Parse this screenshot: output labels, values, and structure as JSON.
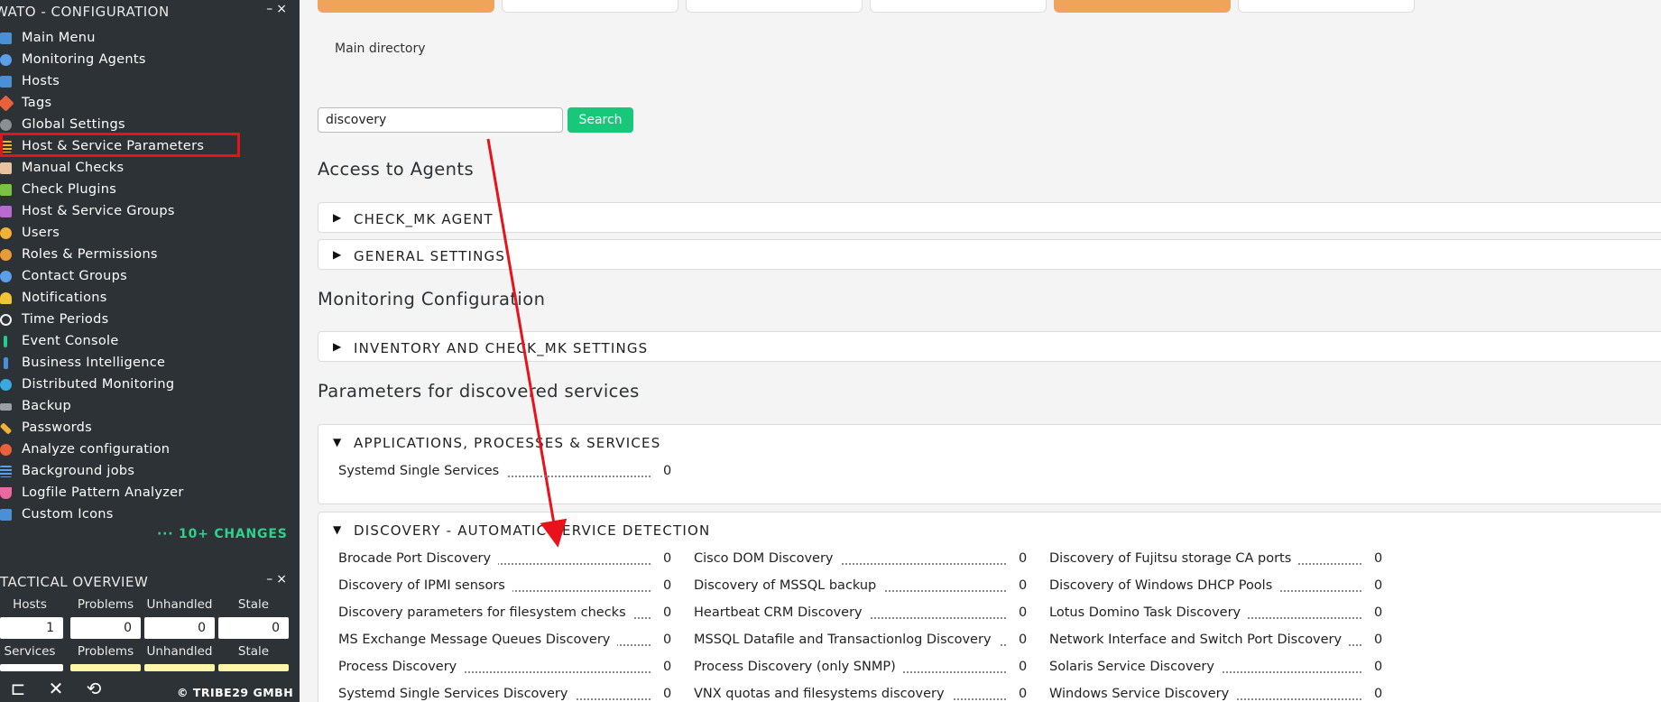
{
  "sidebar": {
    "config_title": "WATO - CONFIGURATION",
    "config_controls": "–×",
    "menu": [
      {
        "label": "Main Menu",
        "icon": "home-icon",
        "color": "#4a90d9"
      },
      {
        "label": "Monitoring Agents",
        "icon": "agent-icon",
        "color": "#5aa0e8"
      },
      {
        "label": "Hosts",
        "icon": "hosts-icon",
        "color": "#4a90d9"
      },
      {
        "label": "Tags",
        "icon": "tag-icon",
        "color": "#e8613a"
      },
      {
        "label": "Global Settings",
        "icon": "gear-icon",
        "color": "#8a8f94"
      },
      {
        "label": "Host & Service Parameters",
        "icon": "parameters-icon",
        "color": "#f2b035"
      },
      {
        "label": "Manual Checks",
        "icon": "hand-icon",
        "color": "#e8c39e"
      },
      {
        "label": "Check Plugins",
        "icon": "puzzle-icon",
        "color": "#7cc242"
      },
      {
        "label": "Host & Service Groups",
        "icon": "groups-icon",
        "color": "#b56bd0"
      },
      {
        "label": "Users",
        "icon": "users-icon",
        "color": "#f2b035"
      },
      {
        "label": "Roles & Permissions",
        "icon": "roles-icon",
        "color": "#e89b3a"
      },
      {
        "label": "Contact Groups",
        "icon": "contact-groups-icon",
        "color": "#5aa0e8"
      },
      {
        "label": "Notifications",
        "icon": "bell-icon",
        "color": "#f2c535"
      },
      {
        "label": "Time Periods",
        "icon": "clock-icon",
        "color": "#f2f2f2"
      },
      {
        "label": "Event Console",
        "icon": "event-console-icon",
        "color": "#1fcf8f"
      },
      {
        "label": "Business Intelligence",
        "icon": "bi-icon",
        "color": "#4a90d9"
      },
      {
        "label": "Distributed Monitoring",
        "icon": "globe-icon",
        "color": "#3aa9e0"
      },
      {
        "label": "Backup",
        "icon": "backup-icon",
        "color": "#9aa0a6"
      },
      {
        "label": "Passwords",
        "icon": "key-icon",
        "color": "#f2b035"
      },
      {
        "label": "Analyze configuration",
        "icon": "analyze-icon",
        "color": "#e8613a"
      },
      {
        "label": "Background jobs",
        "icon": "jobs-icon",
        "color": "#5aa0e8"
      },
      {
        "label": "Logfile Pattern Analyzer",
        "icon": "flask-icon",
        "color": "#e86aa0"
      },
      {
        "label": "Custom Icons",
        "icon": "custom-icons-icon",
        "color": "#4a90d9"
      }
    ],
    "changes": "··· 10+ CHANGES",
    "overview_title": "TACTICAL OVERVIEW",
    "overview_controls": "–×",
    "overview_headers": [
      "Hosts",
      "Problems",
      "Unhandled",
      "Stale"
    ],
    "overview_host_values": [
      "1",
      "0",
      "0",
      "0"
    ],
    "overview_headers2": [
      "Services",
      "Problems",
      "Unhandled",
      "Stale"
    ],
    "copyright": "© TRIBE29 GMBH"
  },
  "main": {
    "breadcrumb": "Main directory",
    "search": {
      "value": "discovery",
      "button": "Search"
    },
    "sections": [
      {
        "title": "Access to Agents"
      },
      {
        "title": "Monitoring Configuration"
      },
      {
        "title": "Parameters for discovered services"
      }
    ],
    "foldbars": [
      {
        "label": "CHECK_MK AGENT",
        "arrow": "▶"
      },
      {
        "label": "GENERAL SETTINGS",
        "arrow": "▶"
      },
      {
        "label": "INVENTORY AND CHECK_MK SETTINGS",
        "arrow": "▶"
      },
      {
        "label": "APPLICATIONS, PROCESSES & SERVICES",
        "arrow": "▼"
      },
      {
        "label": "DISCOVERY - AUTOMATIC SERVICE DETECTION",
        "arrow": "▼"
      }
    ],
    "app_rules": [
      {
        "name": "Systemd Single Services",
        "count": "0"
      }
    ],
    "discovery_rules": [
      {
        "name": "Brocade Port Discovery",
        "count": "0"
      },
      {
        "name": "Cisco DOM Discovery",
        "count": "0"
      },
      {
        "name": "Discovery of Fujitsu storage CA ports",
        "count": "0"
      },
      {
        "name": "Discovery of IPMI sensors",
        "count": "0"
      },
      {
        "name": "Discovery of MSSQL backup",
        "count": "0"
      },
      {
        "name": "Discovery of Windows DHCP Pools",
        "count": "0"
      },
      {
        "name": "Discovery parameters for filesystem checks",
        "count": "0"
      },
      {
        "name": "Heartbeat CRM Discovery",
        "count": "0"
      },
      {
        "name": "Lotus Domino Task Discovery",
        "count": "0"
      },
      {
        "name": "MS Exchange Message Queues Discovery",
        "count": "0"
      },
      {
        "name": "MSSQL Datafile and Transactionlog Discovery",
        "count": "0"
      },
      {
        "name": "Network Interface and Switch Port Discovery",
        "count": "0"
      },
      {
        "name": "Process Discovery",
        "count": "0"
      },
      {
        "name": "Process Discovery (only SNMP)",
        "count": "0"
      },
      {
        "name": "Solaris Service Discovery",
        "count": "0"
      },
      {
        "name": "Systemd Single Services Discovery",
        "count": "0"
      },
      {
        "name": "VNX quotas and filesystems discovery",
        "count": "0"
      },
      {
        "name": "Windows Service Discovery",
        "count": "0"
      }
    ]
  },
  "colors": {
    "sidebar_bg": "#2d3236",
    "accent_green": "#19c77b",
    "highlight_red": "#e8121b",
    "tab_orange": "#f0a45a"
  }
}
